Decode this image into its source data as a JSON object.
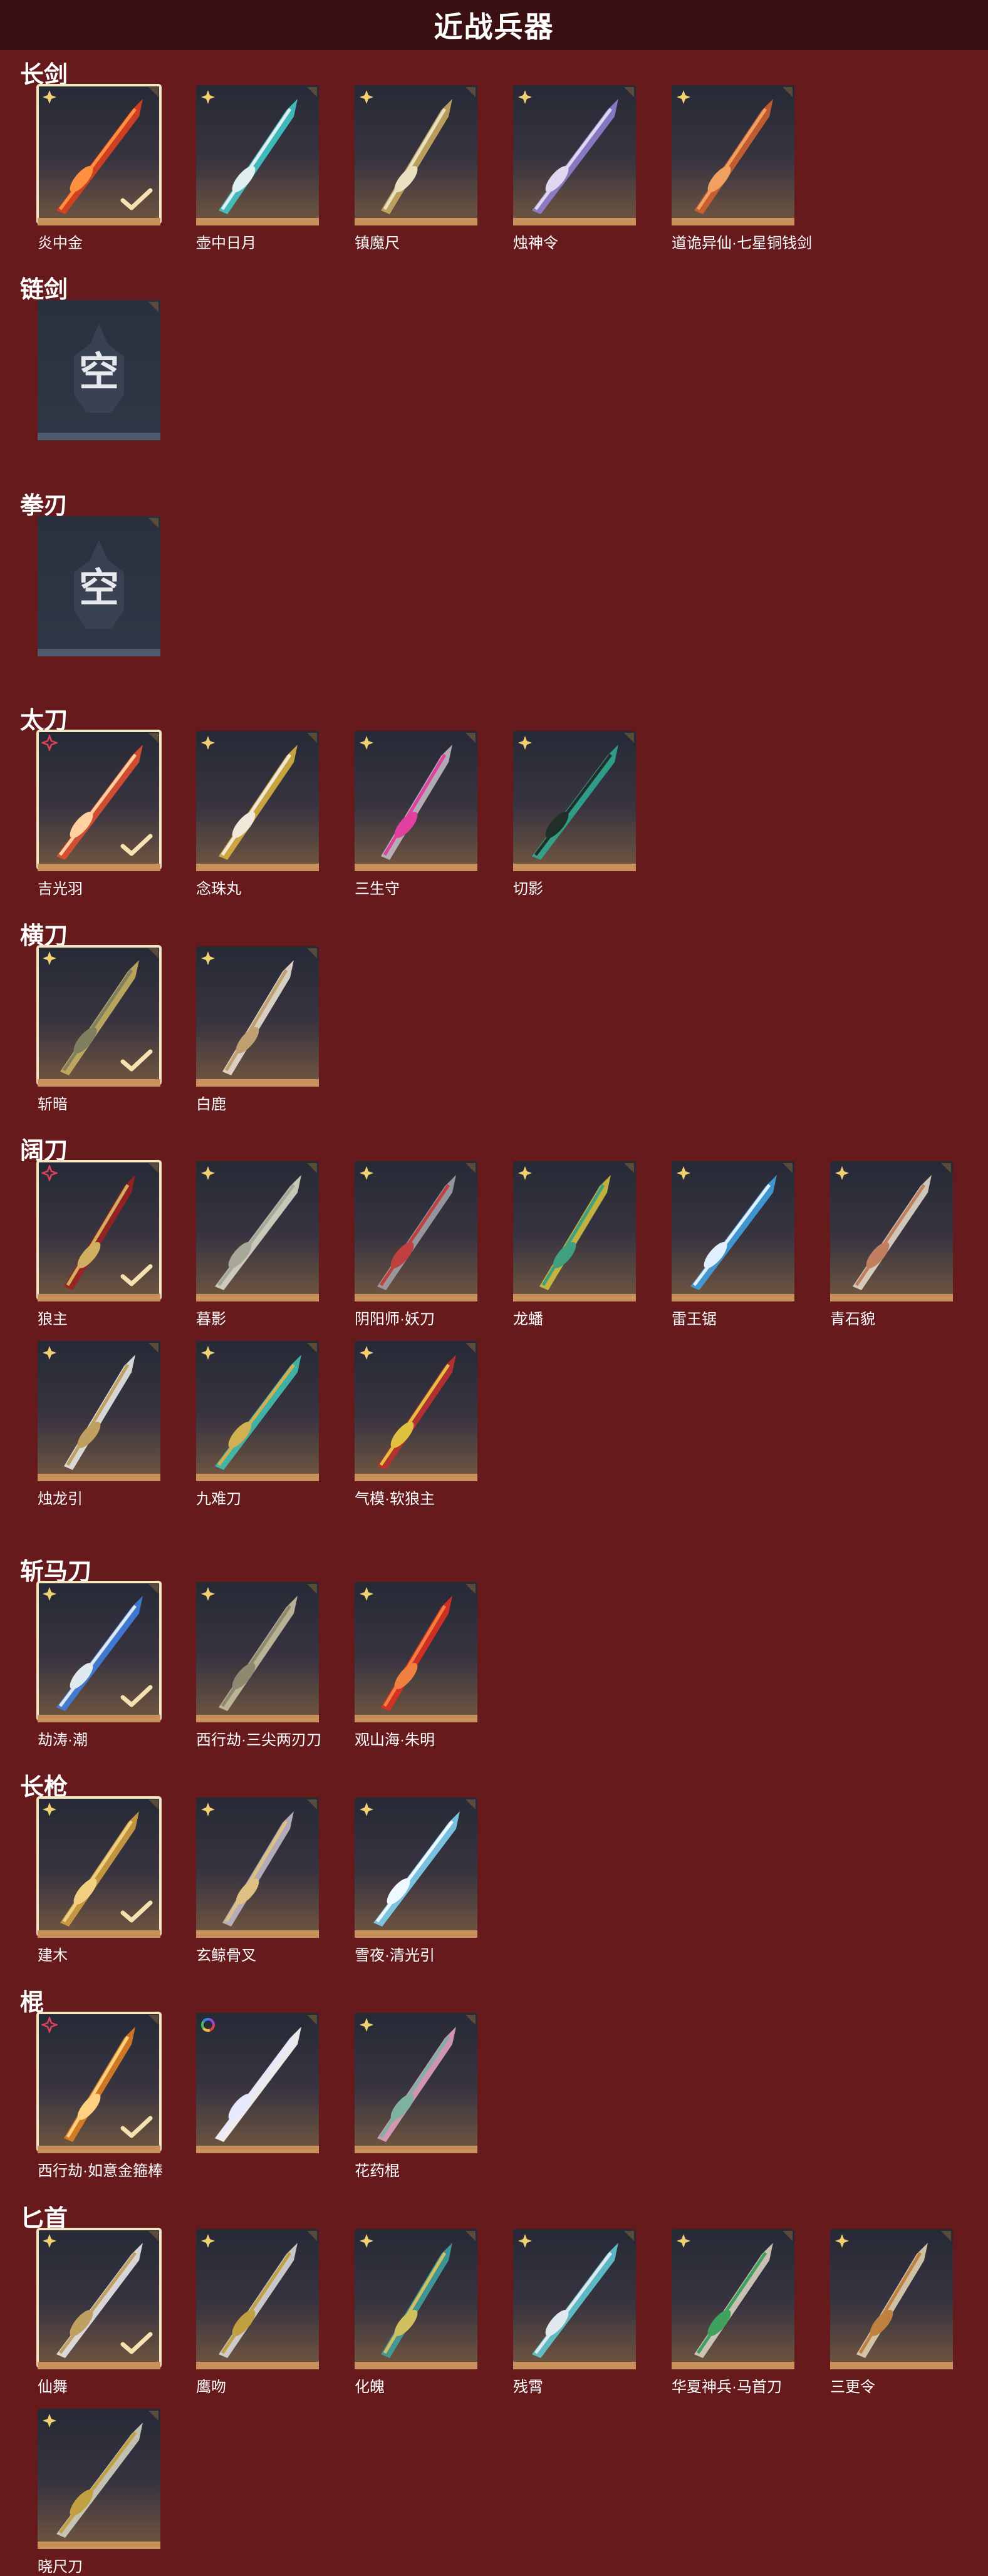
{
  "header": {
    "title": "近战兵器"
  },
  "empty_label": "空",
  "colors": {
    "background": "#661a1c",
    "header": "#3b1012",
    "card_bottom": "#c8905a",
    "selected_border": "#f4e6c0",
    "rank_gold": "#f0d070",
    "rank_red": "#e04058"
  },
  "sections": [
    {
      "title": "长剑",
      "items": [
        {
          "name": "炎中金",
          "rank": "gold",
          "selected": true,
          "palette": [
            "#e04020",
            "#ff9040"
          ]
        },
        {
          "name": "壶中日月",
          "rank": "gold",
          "selected": false,
          "palette": [
            "#40c8c8",
            "#e0f0f0"
          ]
        },
        {
          "name": "镇魔尺",
          "rank": "gold",
          "selected": false,
          "palette": [
            "#c8a860",
            "#e8e0c0"
          ]
        },
        {
          "name": "烛神令",
          "rank": "gold",
          "selected": false,
          "palette": [
            "#9080d0",
            "#e0d8f0"
          ]
        },
        {
          "name": "道诡异仙·七星铜钱剑",
          "rank": "gold",
          "selected": false,
          "palette": [
            "#d06030",
            "#f0a060"
          ]
        }
      ]
    },
    {
      "title": "链剑",
      "items": [
        {
          "empty": true
        }
      ]
    },
    {
      "title": "拳刃",
      "items": [
        {
          "empty": true
        }
      ]
    },
    {
      "title": "太刀",
      "items": [
        {
          "name": "吉光羽",
          "rank": "red",
          "selected": true,
          "palette": [
            "#e05030",
            "#ffd0a0"
          ]
        },
        {
          "name": "念珠丸",
          "rank": "gold",
          "selected": false,
          "palette": [
            "#d8b040",
            "#f0e8d8"
          ]
        },
        {
          "name": "三生守",
          "rank": "gold",
          "selected": false,
          "palette": [
            "#c0b8c0",
            "#e040a0"
          ]
        },
        {
          "name": "切影",
          "rank": "gold",
          "selected": false,
          "palette": [
            "#30a890",
            "#203028"
          ]
        }
      ]
    },
    {
      "title": "横刀",
      "items": [
        {
          "name": "斩暗",
          "rank": "gold",
          "selected": true,
          "palette": [
            "#c8b060",
            "#808060"
          ]
        },
        {
          "name": "白鹿",
          "rank": "gold",
          "selected": false,
          "palette": [
            "#e8e0d0",
            "#c0a070"
          ]
        }
      ]
    },
    {
      "title": "阔刀",
      "items": [
        {
          "name": "狼主",
          "rank": "red",
          "selected": true,
          "palette": [
            "#a02020",
            "#d0b060"
          ]
        },
        {
          "name": "暮影",
          "rank": "gold",
          "selected": false,
          "palette": [
            "#d8d8c8",
            "#a8a898"
          ]
        },
        {
          "name": "阴阳师·妖刀",
          "rank": "gold",
          "selected": false,
          "palette": [
            "#a0a0a8",
            "#c04040"
          ]
        },
        {
          "name": "龙蟠",
          "rank": "gold",
          "selected": false,
          "palette": [
            "#d0c040",
            "#40a080"
          ]
        },
        {
          "name": "雷王锯",
          "rank": "gold",
          "selected": false,
          "palette": [
            "#40a0e0",
            "#e0f0ff"
          ]
        },
        {
          "name": "青石貌",
          "rank": "gold",
          "selected": false,
          "palette": [
            "#e0d8c8",
            "#c08060"
          ]
        },
        {
          "name": "烛龙引",
          "rank": "gold",
          "selected": false,
          "palette": [
            "#e8e8e8",
            "#c0a060"
          ]
        },
        {
          "name": "九难刀",
          "rank": "gold",
          "selected": false,
          "palette": [
            "#40c0b0",
            "#d0b050"
          ]
        },
        {
          "name": "气模·软狼主",
          "rank": "gold",
          "selected": false,
          "palette": [
            "#c03030",
            "#e0c040"
          ]
        }
      ]
    },
    {
      "title": "斩马刀",
      "items": [
        {
          "name": "劫涛·潮",
          "rank": "gold",
          "selected": true,
          "palette": [
            "#4080e0",
            "#e0e8f0"
          ]
        },
        {
          "name": "西行劫·三尖两刃刀",
          "rank": "gold",
          "selected": false,
          "palette": [
            "#c8c0a0",
            "#908870"
          ]
        },
        {
          "name": "观山海·朱明",
          "rank": "gold",
          "selected": false,
          "palette": [
            "#e03020",
            "#f08040"
          ]
        }
      ]
    },
    {
      "title": "长枪",
      "items": [
        {
          "name": "建木",
          "rank": "gold",
          "selected": true,
          "palette": [
            "#d0a040",
            "#f0d080"
          ]
        },
        {
          "name": "玄鲸骨叉",
          "rank": "gold",
          "selected": false,
          "palette": [
            "#c0b8c8",
            "#e0c080"
          ]
        },
        {
          "name": "雪夜·清光引",
          "rank": "gold",
          "selected": false,
          "palette": [
            "#80d0f0",
            "#f0f8ff"
          ]
        }
      ]
    },
    {
      "title": "棍",
      "items": [
        {
          "name": "西行劫·如意金箍棒",
          "rank": "red",
          "selected": true,
          "palette": [
            "#e08020",
            "#ffd080"
          ]
        },
        {
          "name": "",
          "rank": "rainbow",
          "selected": false,
          "palette": [
            "#ffffff",
            "#e8e8ff"
          ]
        },
        {
          "name": "花药棍",
          "rank": "gold",
          "selected": false,
          "palette": [
            "#e0a0c0",
            "#80b0a0"
          ]
        }
      ]
    },
    {
      "title": "匕首",
      "items": [
        {
          "name": "仙舞",
          "rank": "gold",
          "selected": true,
          "palette": [
            "#e8e8e8",
            "#c0a060"
          ]
        },
        {
          "name": "鹰吻",
          "rank": "gold",
          "selected": false,
          "palette": [
            "#d8d8d8",
            "#c0a040"
          ]
        },
        {
          "name": "化魄",
          "rank": "gold",
          "selected": false,
          "palette": [
            "#40a0a0",
            "#d0c060"
          ]
        },
        {
          "name": "残霄",
          "rank": "gold",
          "selected": false,
          "palette": [
            "#60c8d0",
            "#e0e8f0"
          ]
        },
        {
          "name": "华夏神兵·马首刀",
          "rank": "gold",
          "selected": false,
          "palette": [
            "#d8d0c0",
            "#40a060"
          ]
        },
        {
          "name": "三更令",
          "rank": "gold",
          "selected": false,
          "palette": [
            "#e0d0b0",
            "#c08040"
          ]
        },
        {
          "name": "晓尺刀",
          "rank": "gold",
          "selected": false,
          "palette": [
            "#d0d0c0",
            "#c0a040"
          ]
        }
      ]
    }
  ]
}
